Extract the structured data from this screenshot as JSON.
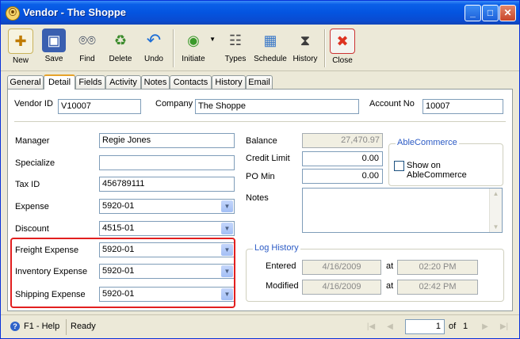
{
  "window": {
    "title": "Vendor - The Shoppe",
    "minimize": "_",
    "maximize": "□",
    "close": "✕"
  },
  "toolbar": {
    "new": "New",
    "save": "Save",
    "find": "Find",
    "delete": "Delete",
    "undo": "Undo",
    "initiate": "Initiate",
    "types": "Types",
    "schedule": "Schedule",
    "history": "History",
    "close": "Close"
  },
  "tabs": [
    "General",
    "Detail",
    "Fields",
    "Activity",
    "Notes",
    "Contacts",
    "History",
    "Email"
  ],
  "header": {
    "vendor_id_label": "Vendor ID",
    "vendor_id": "V10007",
    "company_label": "Company",
    "company": "The Shoppe",
    "account_no_label": "Account No",
    "account_no": "10007"
  },
  "left": {
    "manager_label": "Manager",
    "manager": "Regie Jones",
    "specialize_label": "Specialize",
    "specialize": "",
    "tax_id_label": "Tax ID",
    "tax_id": "456789111",
    "expense_label": "Expense",
    "expense": "5920-01",
    "discount_label": "Discount",
    "discount": "4515-01",
    "freight_label": "Freight Expense",
    "freight": "5920-01",
    "inventory_label": "Inventory Expense",
    "inventory": "5920-01",
    "shipping_label": "Shipping Expense",
    "shipping": "5920-01"
  },
  "right": {
    "balance_label": "Balance",
    "balance": "27,470.97",
    "credit_limit_label": "Credit Limit",
    "credit_limit": "0.00",
    "po_min_label": "PO Min",
    "po_min": "0.00",
    "notes_label": "Notes",
    "notes": ""
  },
  "ablecommerce": {
    "legend": "AbleCommerce",
    "checkbox_label": "Show on AbleCommerce",
    "checked": false
  },
  "log_history": {
    "legend": "Log History",
    "entered_label": "Entered",
    "entered_date": "4/16/2009",
    "at1": "at",
    "entered_time": "02:20 PM",
    "modified_label": "Modified",
    "modified_date": "4/16/2009",
    "at2": "at",
    "modified_time": "02:42 PM"
  },
  "status": {
    "help": "F1 - Help",
    "state": "Ready",
    "page": "1",
    "of": "of",
    "total": "1"
  }
}
